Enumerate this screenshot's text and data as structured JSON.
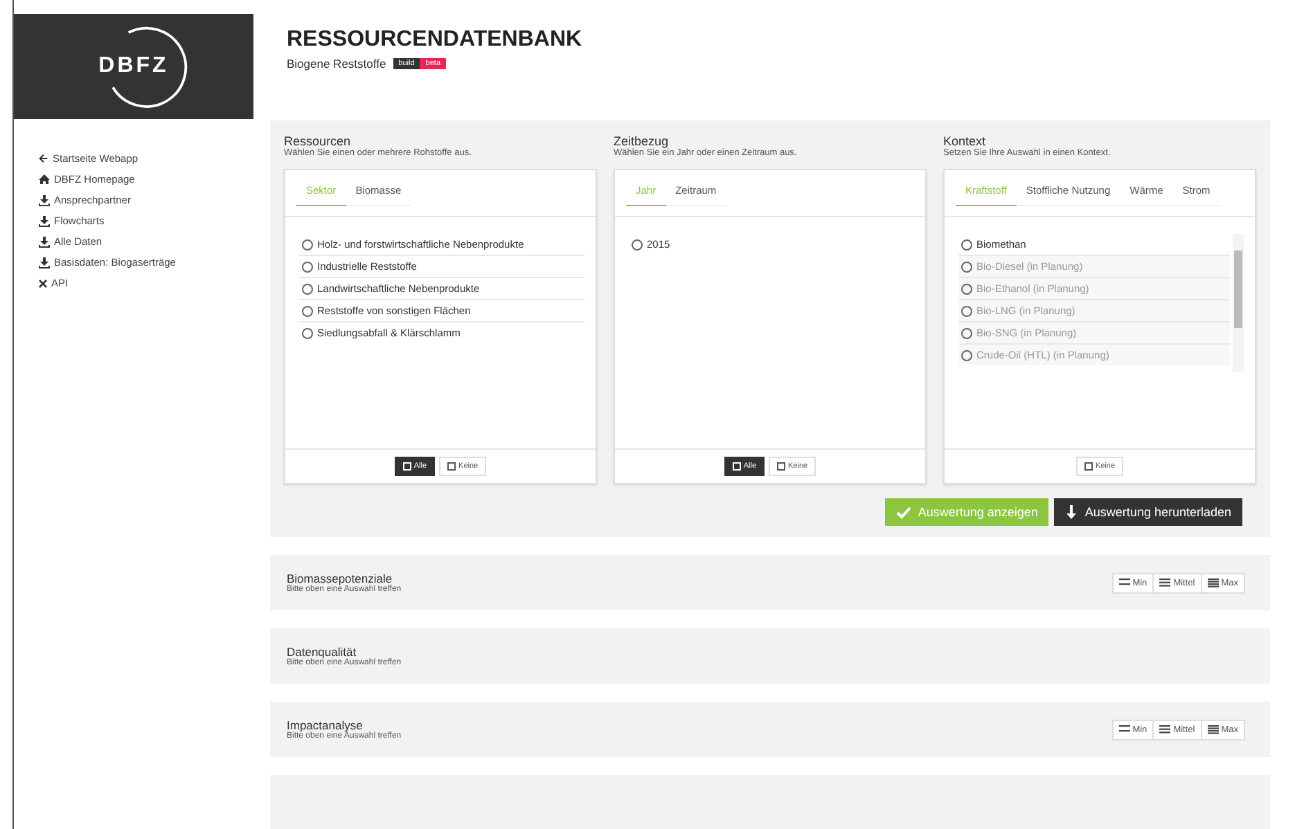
{
  "logo": {
    "text": "DBFZ"
  },
  "header": {
    "title": "RESSOURCENDATENBANK",
    "subtitle": "Biogene Reststoffe",
    "badges": [
      {
        "label": "build",
        "color": "#333333"
      },
      {
        "label": "beta",
        "color": "#e8245a"
      }
    ]
  },
  "sidebar": {
    "items": [
      {
        "kind": "back",
        "label": "Startseite Webapp"
      },
      {
        "kind": "home",
        "label": "DBFZ Homepage"
      },
      {
        "kind": "download",
        "label": "Ansprechpartner"
      },
      {
        "kind": "download",
        "label": "Flowcharts"
      },
      {
        "kind": "download",
        "label": "Alle Daten"
      },
      {
        "kind": "download",
        "label": "Basisdaten: Biogaserträge"
      },
      {
        "kind": "api",
        "label": "API"
      }
    ]
  },
  "panels": [
    {
      "title": "Ressourcen",
      "description": "Wählen Sie einen oder mehrere Rohstoffe aus.",
      "tabs": [
        {
          "label": "Sektor",
          "selected": true
        },
        {
          "label": "Biomasse",
          "selected": false
        }
      ],
      "options": [
        {
          "label": "Holz- und forstwirtschaftliche Nebenprodukte",
          "selected": false,
          "disabled": false
        },
        {
          "label": "Industrielle Reststoffe",
          "selected": false,
          "disabled": false
        },
        {
          "label": "Landwirtschaftliche Nebenprodukte",
          "selected": false,
          "disabled": false
        },
        {
          "label": "Reststoffe von sonstigen Flächen",
          "selected": false,
          "disabled": false
        },
        {
          "label": "Siedlungsabfall & Klärschlamm",
          "selected": false,
          "disabled": false
        }
      ],
      "footer_buttons": [
        {
          "label": "Alle",
          "selected": true
        },
        {
          "label": "Keine",
          "selected": false
        }
      ]
    },
    {
      "title": "Zeitbezug",
      "description": "Wählen Sie ein Jahr oder einen Zeitraum aus.",
      "tabs": [
        {
          "label": "Jahr",
          "selected": true
        },
        {
          "label": "Zeitraum",
          "selected": false
        }
      ],
      "options": [
        {
          "label": "2015",
          "selected": false,
          "disabled": false
        }
      ],
      "footer_buttons": [
        {
          "label": "Alle",
          "selected": true
        },
        {
          "label": "Keine",
          "selected": false
        }
      ]
    },
    {
      "title": "Kontext",
      "description": "Setzen Sie Ihre Auswahl in einen Kontext.",
      "tabs": [
        {
          "label": "Kraftstoff",
          "selected": true
        },
        {
          "label": "Stoffliche Nutzung",
          "selected": false
        },
        {
          "label": "Wärme",
          "selected": false
        },
        {
          "label": "Strom",
          "selected": false
        }
      ],
      "options": [
        {
          "label": "Biomethan",
          "selected": false,
          "disabled": false
        },
        {
          "label": "Bio-Diesel (in Planung)",
          "selected": false,
          "disabled": true
        },
        {
          "label": "Bio-Ethanol (in Planung)",
          "selected": false,
          "disabled": true
        },
        {
          "label": "Bio-LNG (in Planung)",
          "selected": false,
          "disabled": true
        },
        {
          "label": "Bio-SNG (in Planung)",
          "selected": false,
          "disabled": true
        },
        {
          "label": "Crude-Oil (HTL) (in Planung)",
          "selected": false,
          "disabled": true
        }
      ],
      "footer_buttons": [
        {
          "label": "Keine",
          "selected": false
        }
      ]
    }
  ],
  "actions": [
    {
      "kind": "primary",
      "label": "Auswertung anzeigen"
    },
    {
      "kind": "download",
      "label": "Auswertung herunterladen"
    }
  ],
  "sections": [
    {
      "title": "Biomassepotenziale",
      "hint": "Bitte oben eine Auswahl treffen",
      "buttons": [
        {
          "kind": "min",
          "label": "Min"
        },
        {
          "kind": "mid",
          "label": "Mittel"
        },
        {
          "kind": "max",
          "label": "Max"
        }
      ]
    },
    {
      "title": "Datenqualität",
      "hint": "Bitte oben eine Auswahl treffen"
    },
    {
      "title": "Impactanalyse",
      "hint": "Bitte oben eine Auswahl treffen",
      "buttons": [
        {
          "kind": "min",
          "label": "Min"
        },
        {
          "kind": "mid",
          "label": "Mittel"
        },
        {
          "kind": "max",
          "label": "Max"
        }
      ]
    }
  ]
}
